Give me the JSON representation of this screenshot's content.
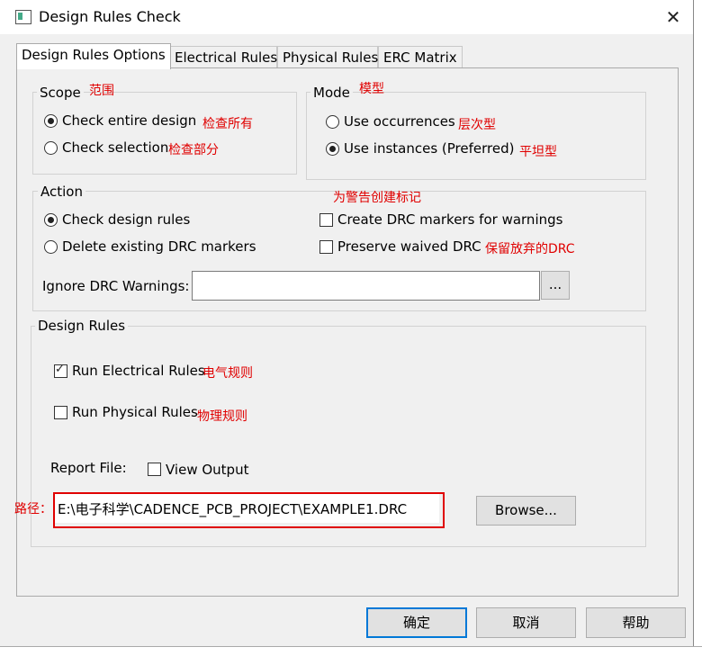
{
  "window": {
    "title": "Design Rules Check",
    "close_glyph": "✕"
  },
  "tabs": [
    {
      "label": "Design Rules Options",
      "active": true
    },
    {
      "label": "Electrical Rules"
    },
    {
      "label": "Physical Rules"
    },
    {
      "label": "ERC Matrix"
    }
  ],
  "scope": {
    "title": "Scope",
    "title_note": "范围",
    "entire_label": "Check entire design",
    "entire_note": "检查所有",
    "entire_selected": true,
    "selection_label": "Check selection",
    "selection_note": "检查部分"
  },
  "mode": {
    "title": "Mode",
    "title_note": "模型",
    "occurrences_label": "Use occurrences",
    "occurrences_note": "层次型",
    "instances_label": "Use instances (Preferred)",
    "instances_note": "平坦型",
    "instances_selected": true
  },
  "action": {
    "title": "Action",
    "check_rules_label": "Check design rules",
    "check_rules_selected": true,
    "delete_markers_label": "Delete existing DRC markers",
    "create_markers_label": "Create DRC markers for warnings",
    "create_markers_note": "为警告创建标记",
    "preserve_label": "Preserve waived DRC",
    "preserve_note": "保留放弃的DRC",
    "ignore_label": "Ignore DRC Warnings:",
    "ignore_value": "",
    "ignore_browse": "..."
  },
  "design_rules": {
    "title": "Design Rules",
    "run_electrical_label": "Run Electrical Rules",
    "run_electrical_note": "电气规则",
    "run_electrical_checked": true,
    "run_physical_label": "Run Physical Rules",
    "run_physical_note": "物理规则",
    "run_physical_checked": false,
    "report_label": "Report File:",
    "view_output_label": "View Output",
    "path_note": "路径：",
    "report_path": "E:\\电子科学\\CADENCE_PCB_PROJECT\\EXAMPLE1.DRC",
    "browse_label": "Browse..."
  },
  "footer": {
    "ok_label": "确定",
    "cancel_label": "取消",
    "help_label": "帮助"
  },
  "colors": {
    "annotation": "#e00000",
    "accent": "#0078d7"
  }
}
